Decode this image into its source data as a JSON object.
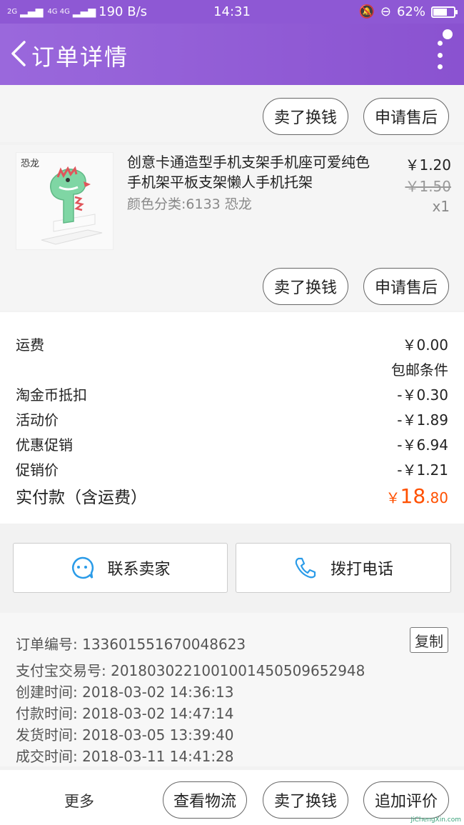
{
  "status_bar": {
    "network_1": "2G",
    "network_2": "4G 4G",
    "speed": "190 B/s",
    "time": "14:31",
    "battery": "62%",
    "battery_level": 0.62
  },
  "header": {
    "title": "订单详情"
  },
  "top_actions": {
    "sell_label": "卖了换钱",
    "after_sale_label": "申请售后"
  },
  "item": {
    "image_tag": "恐龙",
    "title": "创意卡通造型手机支架手机座可爱纯色手机架平板支架懒人手机托架",
    "sku": "颜色分类:6133 恐龙",
    "price_now": "￥1.20",
    "price_old": "￥1.50",
    "quantity": "x1",
    "sell_label": "卖了换钱",
    "after_sale_label": "申请售后"
  },
  "fees": {
    "shipping_label": "运费",
    "shipping_value": "￥0.00",
    "free_shipping_label": "包邮条件",
    "rows": [
      {
        "label": "淘金币抵扣",
        "value": "-￥0.30"
      },
      {
        "label": "活动价",
        "value": "-￥1.89"
      },
      {
        "label": "优惠促销",
        "value": "-￥6.94"
      },
      {
        "label": "促销价",
        "value": "-￥1.21"
      }
    ],
    "total_label": "实付款（含运费）",
    "total_currency": "￥",
    "total_int": "18",
    "total_dec": ".80"
  },
  "contact": {
    "seller_label": "联系卖家",
    "phone_label": "拨打电话"
  },
  "order_info": {
    "order_no": "订单编号: 133601551670048623",
    "copy_label": "复制",
    "alipay_no": "支付宝交易号: 2018030221001001450509652948",
    "created": "创建时间: 2018-03-02 14:36:13",
    "paid": "付款时间: 2018-03-02 14:47:14",
    "shipped": "发货时间: 2018-03-05 13:39:40",
    "completed": "成交时间: 2018-03-11 14:41:28"
  },
  "bottom_bar": {
    "more_label": "更多",
    "logistics_label": "查看物流",
    "sell_label": "卖了换钱",
    "review_label": "追加评价",
    "watermark": "JiChengXin.com"
  },
  "colors": {
    "header": "#8e58d4",
    "price_accent": "#ff5000",
    "icon_blue": "#2a9be8"
  }
}
